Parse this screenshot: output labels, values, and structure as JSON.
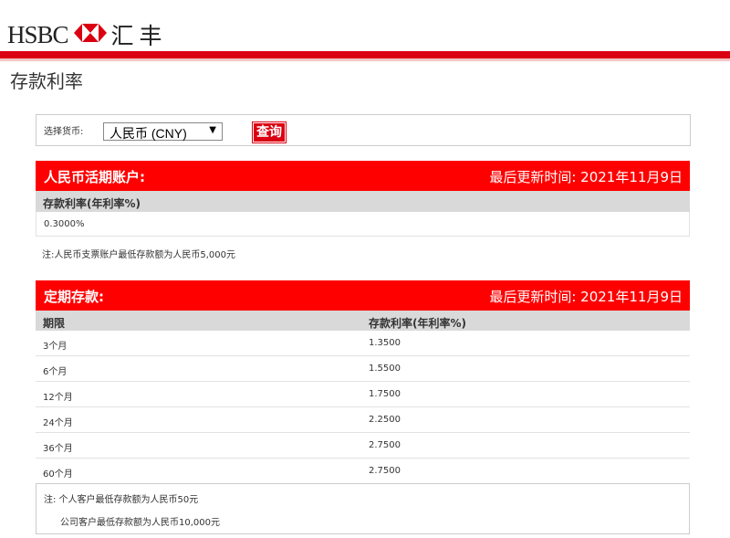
{
  "header": {
    "logo_text": "HSBC",
    "logo_cn": "汇丰",
    "logo_colors": {
      "red": "#db0011",
      "white": "#ffffff"
    }
  },
  "page_title": "存款利率",
  "selector": {
    "label": "选择货币:",
    "currency_value": "人民币 (CNY)",
    "query_button": "查询"
  },
  "current_account": {
    "title": "人民币活期账户:",
    "updated": "最后更新时间:  2021年11月9日",
    "col_rate": "存款利率(年利率%)",
    "rate": "0.3000%",
    "note": "注:人民币支票账户最低存款额为人民币5,000元"
  },
  "time_deposit": {
    "title": "定期存款:",
    "updated": "最后更新时间:  2021年11月9日",
    "col_term": "期限",
    "col_rate": "存款利率(年利率%)",
    "rows": [
      {
        "term": "3个月",
        "rate": "1.3500"
      },
      {
        "term": "6个月",
        "rate": "1.5500"
      },
      {
        "term": "12个月",
        "rate": "1.7500"
      },
      {
        "term": "24个月",
        "rate": "2.2500"
      },
      {
        "term": "36个月",
        "rate": "2.7500"
      },
      {
        "term": "60个月",
        "rate": "2.7500"
      }
    ],
    "note1": "注: 个人客户最低存款额为人民币50元",
    "note2": "公司客户最低存款额为人民币10,000元"
  },
  "accent_color": "#ff0000"
}
